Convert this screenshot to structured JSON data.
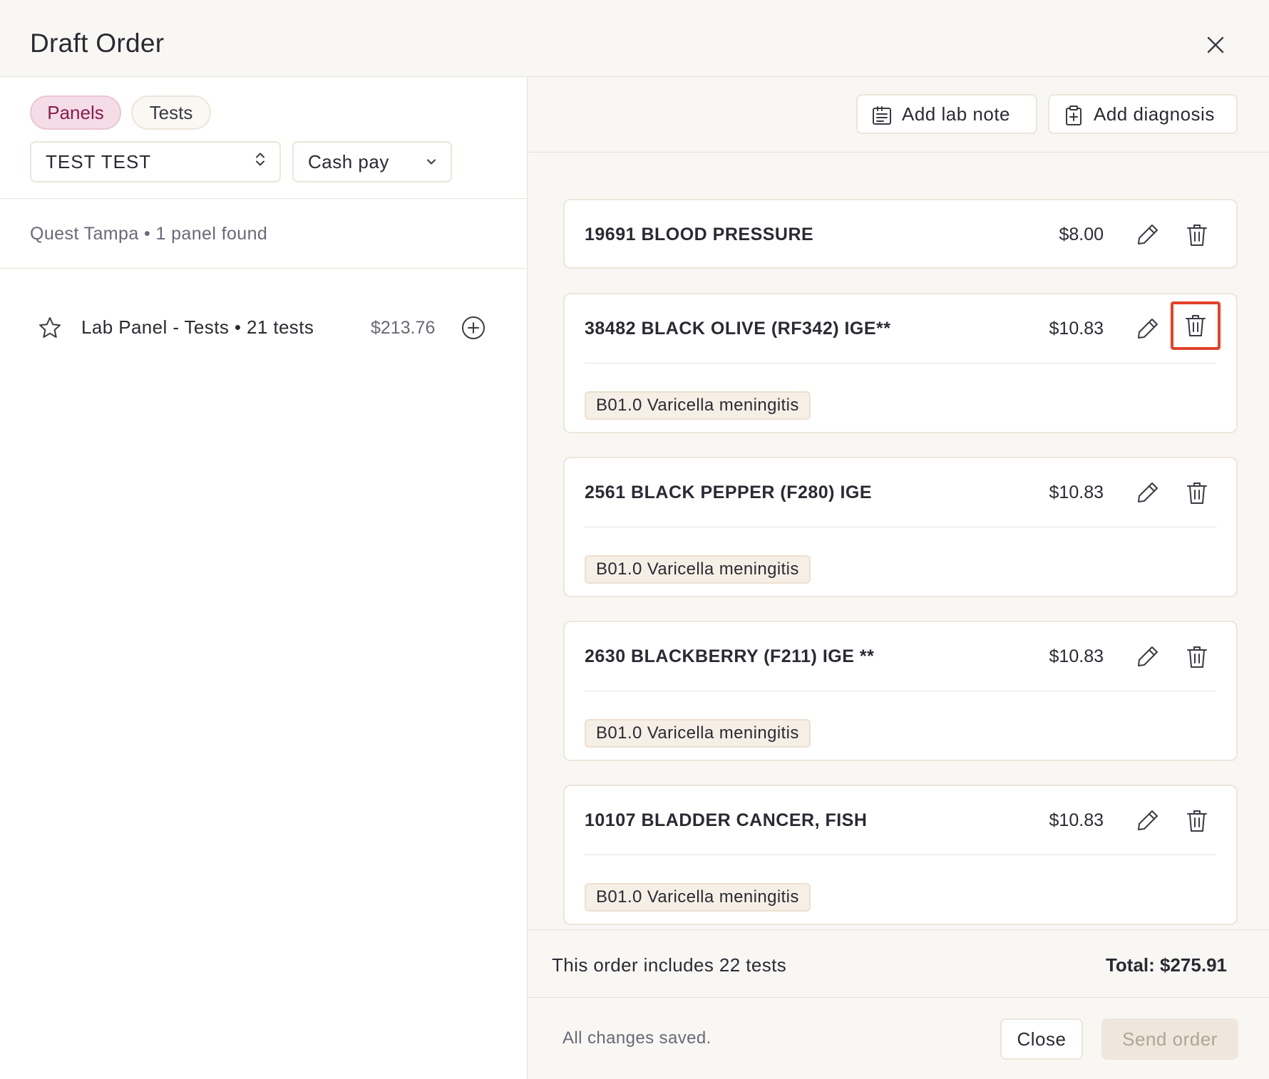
{
  "header": {
    "title": "Draft Order"
  },
  "left": {
    "tabs": [
      {
        "label": "Panels",
        "active": true
      },
      {
        "label": "Tests",
        "active": false
      }
    ],
    "patient_select": {
      "value": "TEST TEST"
    },
    "payment_select": {
      "value": "Cash pay"
    },
    "found_text": "Quest Tampa • 1 panel found",
    "panel": {
      "name": "Lab Panel - Tests • 21 tests",
      "price": "$213.76"
    }
  },
  "toolbar": {
    "lab_note_label": "Add lab note",
    "diagnosis_label": "Add diagnosis"
  },
  "orders": [
    {
      "name": "19691 BLOOD PRESSURE",
      "price": "$8.00",
      "diagnosis": ""
    },
    {
      "name": "38482 BLACK OLIVE (RF342) IGE**",
      "price": "$10.83",
      "diagnosis": "B01.0 Varicella meningitis"
    },
    {
      "name": "2561 BLACK PEPPER (F280) IGE",
      "price": "$10.83",
      "diagnosis": "B01.0 Varicella meningitis"
    },
    {
      "name": "2630 BLACKBERRY (F211) IGE **",
      "price": "$10.83",
      "diagnosis": "B01.0 Varicella meningitis"
    },
    {
      "name": "10107 BLADDER CANCER, FISH",
      "price": "$10.83",
      "diagnosis": "B01.0 Varicella meningitis"
    }
  ],
  "summary": {
    "count_text": "This order includes 22 tests",
    "total_text": "Total: $275.91"
  },
  "footer": {
    "saved_text": "All changes saved.",
    "close_label": "Close",
    "send_label": "Send order"
  },
  "colors": {
    "accent_pink": "#f5dde7",
    "highlight_red": "#e2412a",
    "badge_bg": "#f6efe6"
  },
  "icons": [
    "close-icon",
    "chevron-updown-icon",
    "chevron-down-icon",
    "star-icon",
    "plus-circle-icon",
    "clipboard-note-icon",
    "clipboard-plus-icon",
    "pencil-icon",
    "trash-icon"
  ]
}
